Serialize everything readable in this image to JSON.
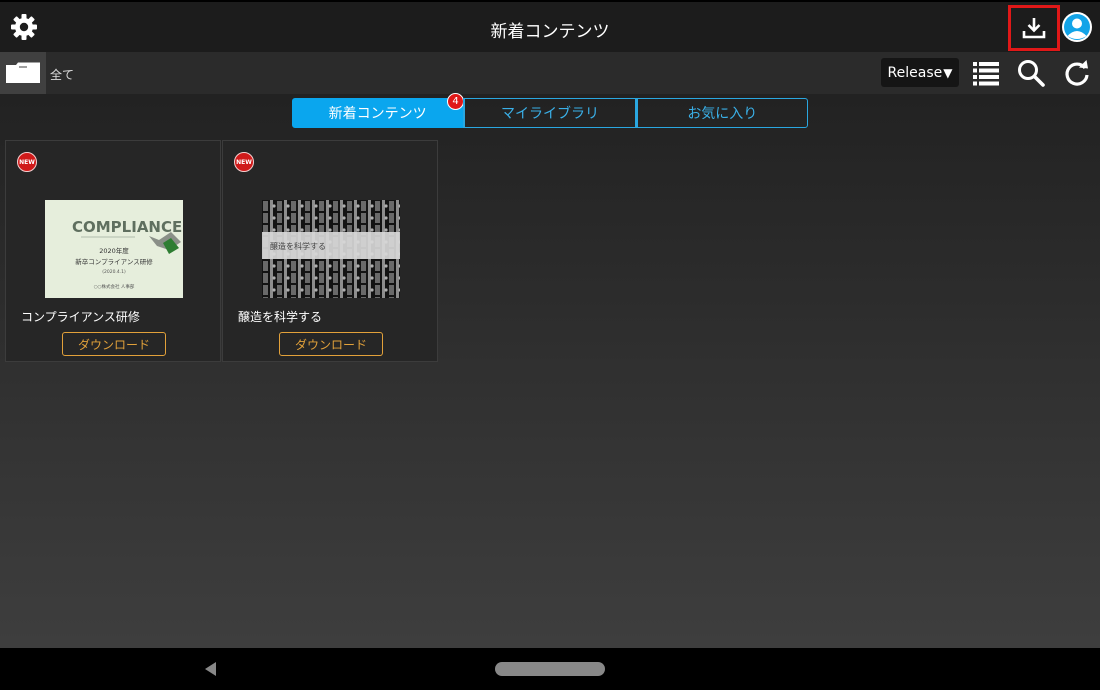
{
  "header": {
    "title": "新着コンテンツ",
    "settings_icon": "gear-icon",
    "download_icon": "download-icon",
    "account_icon": "user-avatar-icon"
  },
  "toolbar": {
    "folder_label": "全て",
    "sort_label": "Release",
    "sort_arrow": "▼",
    "icons": [
      "list-view-icon",
      "search-icon",
      "refresh-icon"
    ]
  },
  "tabs": [
    {
      "label": "新着コンテンツ",
      "active": true,
      "badge": "4"
    },
    {
      "label": "マイライブラリ",
      "active": false
    },
    {
      "label": "お気に入り",
      "active": false
    }
  ],
  "cards": [
    {
      "badge": "NEW",
      "title": "コンプライアンス研修",
      "button": "ダウンロード",
      "thumb": {
        "heading": "COMPLIANCE",
        "line1": "2020年度",
        "line2": "新卒コンプライアンス研修",
        "line3": "(2020.4.1)",
        "footer": "○○株式会社 人事部"
      }
    },
    {
      "badge": "NEW",
      "title": "醸造を科学する",
      "button": "ダウンロード",
      "thumb": {
        "caption": "醸造を科学する"
      }
    }
  ],
  "colors": {
    "accent": "#0aa6ee",
    "badge_red": "#e01818",
    "download_orange": "#e2a13a"
  }
}
